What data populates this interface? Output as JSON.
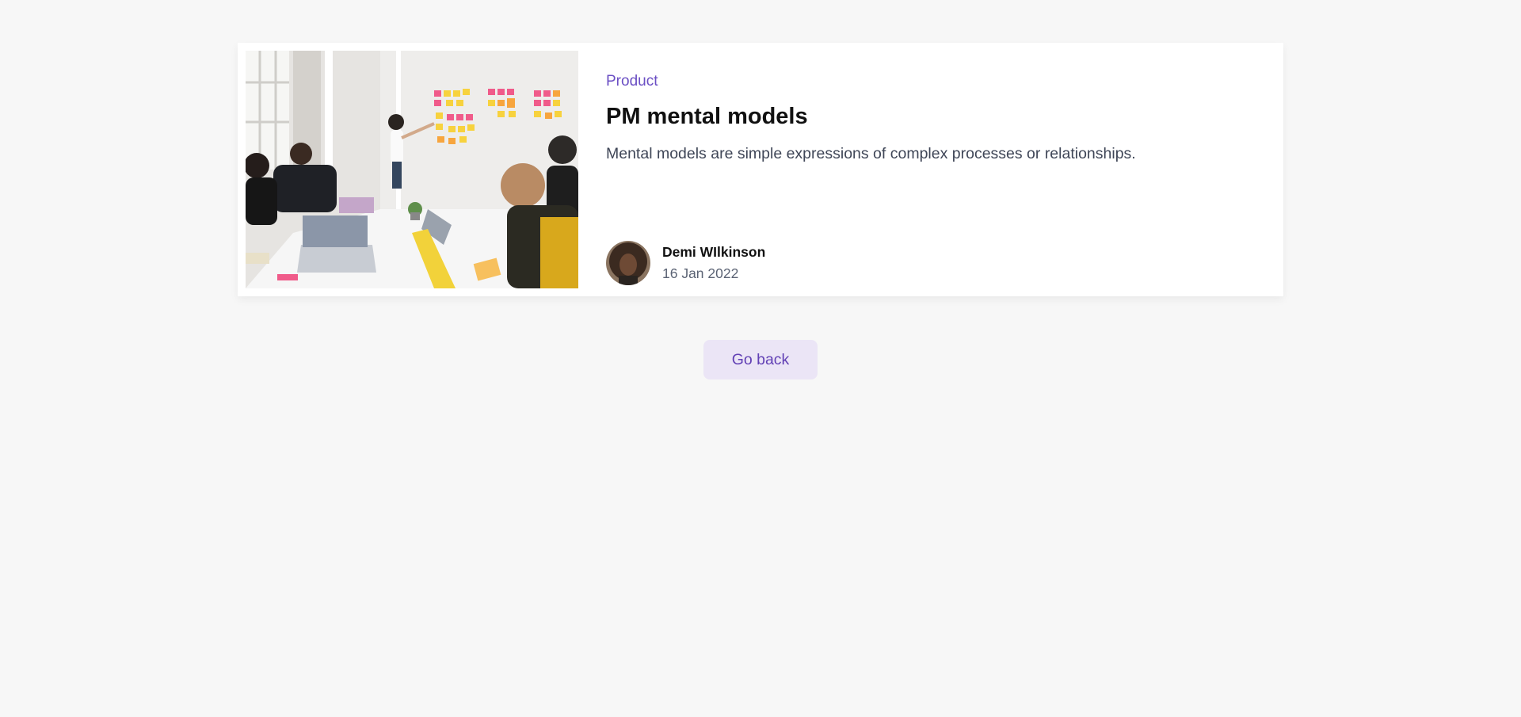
{
  "post": {
    "category": "Product",
    "title": "PM mental models",
    "excerpt": "Mental models are simple expressions of complex processes or relationships.",
    "author": {
      "name": "Demi WIlkinson",
      "date": "16 Jan 2022"
    }
  },
  "actions": {
    "go_back_label": "Go back"
  },
  "colors": {
    "accent": "#6b4fc4",
    "button_bg": "#ebe5f6",
    "page_bg": "#f7f7f7"
  }
}
